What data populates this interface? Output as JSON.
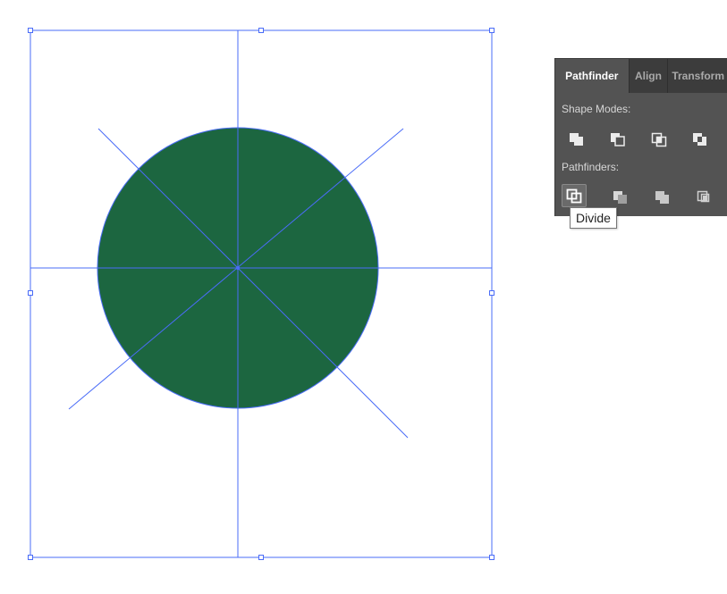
{
  "colors": {
    "circle_fill": "#1c6640",
    "guide_line": "#4a6cf7",
    "panel_bg": "#535353",
    "tab_bar_bg": "#3c3c3c"
  },
  "pathfinder_panel": {
    "tabs": [
      {
        "label": "Pathfinder",
        "active": true
      },
      {
        "label": "Align",
        "active": false
      },
      {
        "label": "Transform",
        "active": false
      }
    ],
    "shape_modes_label": "Shape Modes:",
    "shape_modes": [
      {
        "icon": "unite-icon"
      },
      {
        "icon": "minus-front-icon"
      },
      {
        "icon": "intersect-icon"
      },
      {
        "icon": "exclude-icon"
      }
    ],
    "pathfinders_label": "Pathfinders:",
    "pathfinders": [
      {
        "icon": "divide-icon",
        "active": true
      },
      {
        "icon": "trim-icon"
      },
      {
        "icon": "merge-icon"
      },
      {
        "icon": "crop-icon"
      }
    ]
  },
  "tooltip": {
    "text": "Divide"
  }
}
